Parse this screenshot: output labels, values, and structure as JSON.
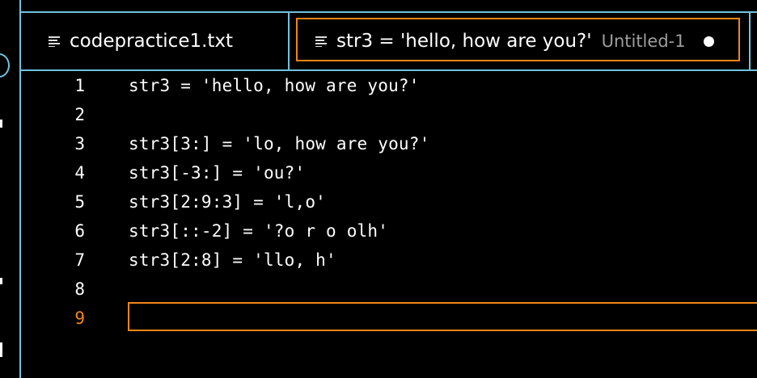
{
  "tabs": [
    {
      "label": "codepractice1.txt",
      "icon": "text-file-icon",
      "active": false
    },
    {
      "label": "str3 = 'hello, how are you?'",
      "description": "Untitled-1",
      "icon": "text-file-icon",
      "active": true,
      "dirty": true
    }
  ],
  "editor": {
    "current_line": 9,
    "lines": [
      {
        "number": "1",
        "text": "str3 = 'hello, how are you?'"
      },
      {
        "number": "2",
        "text": ""
      },
      {
        "number": "3",
        "text": "str3[3:] = 'lo, how are you?'"
      },
      {
        "number": "4",
        "text": "str3[-3:] = 'ou?'"
      },
      {
        "number": "5",
        "text": "str3[2:9:3] = 'l,o'"
      },
      {
        "number": "6",
        "text": "str3[::-2] = '?o r o olh'"
      },
      {
        "number": "7",
        "text": "str3[2:8] = 'llo, h'"
      },
      {
        "number": "8",
        "text": ""
      },
      {
        "number": "9",
        "text": ""
      }
    ]
  },
  "colors": {
    "accent": "#f38518",
    "border": "#6fc3df",
    "background": "#000000"
  }
}
